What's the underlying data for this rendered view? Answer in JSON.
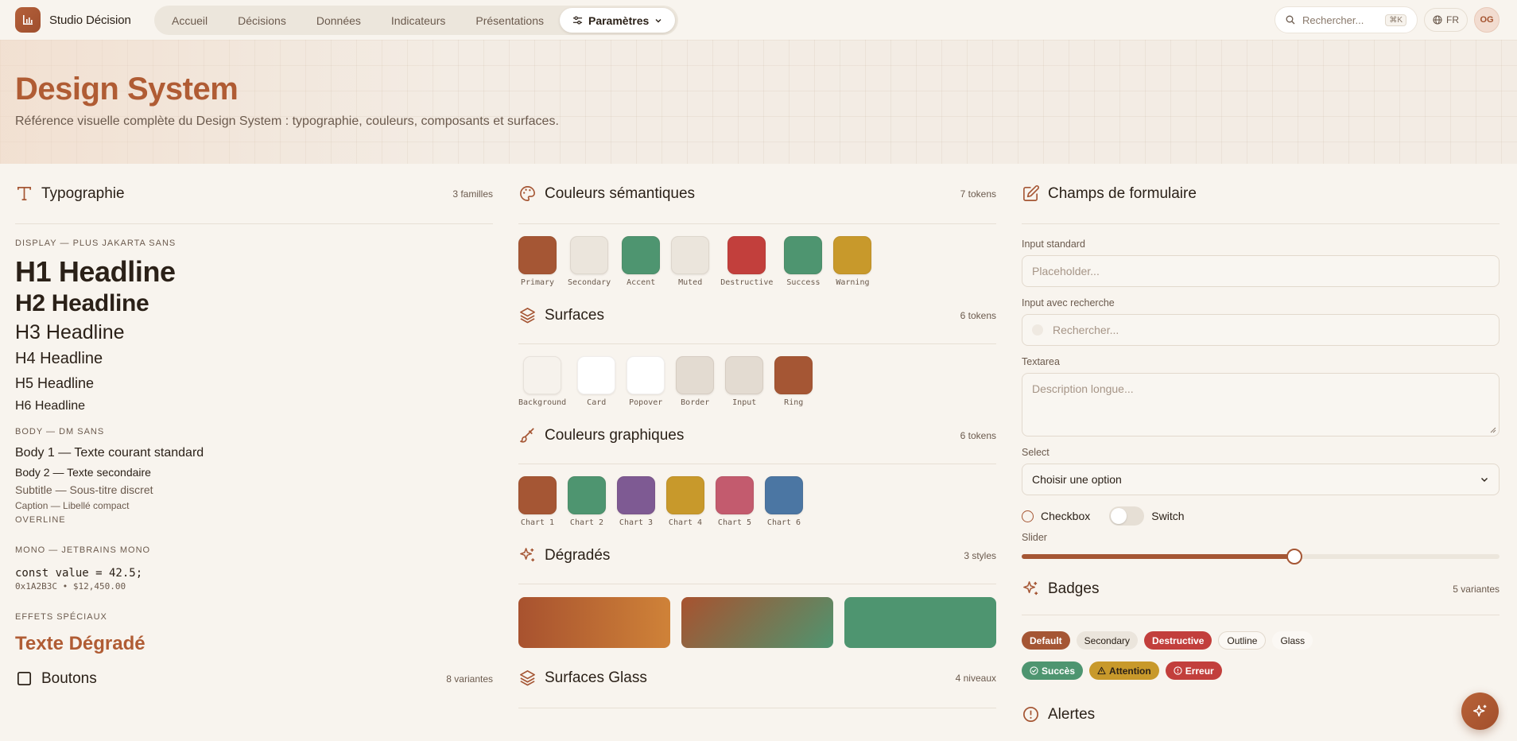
{
  "brand": {
    "name": "Studio Décision"
  },
  "nav": {
    "items": [
      {
        "label": "Accueil"
      },
      {
        "label": "Décisions"
      },
      {
        "label": "Données"
      },
      {
        "label": "Indicateurs"
      },
      {
        "label": "Présentations"
      }
    ],
    "active_label": "Paramètres"
  },
  "search": {
    "placeholder": "Rechercher...",
    "shortcut": "⌘K"
  },
  "lang": "FR",
  "avatar": "OG",
  "hero": {
    "title": "Design System",
    "subtitle": "Référence visuelle complète du Design System : typographie, couleurs, composants et surfaces."
  },
  "typography": {
    "title": "Typographie",
    "count": "3 familles",
    "display_overline": "Display — Plus Jakarta Sans",
    "headings": [
      "H1 Headline",
      "H2 Headline",
      "H3 Headline",
      "H4 Headline",
      "H5 Headline",
      "H6 Headline"
    ],
    "body_overline": "Body — DM Sans",
    "body1": "Body 1 — Texte courant standard",
    "body2": "Body 2 — Texte secondaire",
    "subtitle": "Subtitle — Sous-titre discret",
    "caption": "Caption — Libellé compact",
    "overline": "Overline",
    "mono_overline": "Mono — JetBrains Mono",
    "mono_code": "const value = 42.5;",
    "mono_small": "0x1A2B3C • $12,450.00",
    "effects_overline": "Effets spéciaux",
    "gradient_text": "Texte Dégradé"
  },
  "buttons": {
    "title": "Boutons",
    "count": "8 variantes"
  },
  "semantic_colors": {
    "title": "Couleurs sémantiques",
    "count": "7 tokens",
    "items": [
      {
        "label": "Primary",
        "color": "#a55634"
      },
      {
        "label": "Secondary",
        "color": "#ebe5dc"
      },
      {
        "label": "Accent",
        "color": "#4e9570"
      },
      {
        "label": "Muted",
        "color": "#ebe5dc"
      },
      {
        "label": "Destructive",
        "color": "#c23f3c"
      },
      {
        "label": "Success",
        "color": "#4e9570"
      },
      {
        "label": "Warning",
        "color": "#c8992b"
      }
    ]
  },
  "surfaces": {
    "title": "Surfaces",
    "count": "6 tokens",
    "items": [
      {
        "label": "Background",
        "color": "#f6f2ec"
      },
      {
        "label": "Card",
        "color": "#ffffff"
      },
      {
        "label": "Popover",
        "color": "#ffffff"
      },
      {
        "label": "Border",
        "color": "#e3dbd1"
      },
      {
        "label": "Input",
        "color": "#e3dbd1"
      },
      {
        "label": "Ring",
        "color": "#a55634"
      }
    ]
  },
  "chart_colors": {
    "title": "Couleurs graphiques",
    "count": "6 tokens",
    "items": [
      {
        "label": "Chart 1",
        "color": "#a55634"
      },
      {
        "label": "Chart 2",
        "color": "#4e9570"
      },
      {
        "label": "Chart 3",
        "color": "#7e5a93"
      },
      {
        "label": "Chart 4",
        "color": "#c8992b"
      },
      {
        "label": "Chart 5",
        "color": "#c35b6e"
      },
      {
        "label": "Chart 6",
        "color": "#4b76a3"
      }
    ]
  },
  "gradients": {
    "title": "Dégradés",
    "count": "3 styles"
  },
  "glass": {
    "title": "Surfaces Glass",
    "count": "4 niveaux"
  },
  "forms": {
    "title": "Champs de formulaire",
    "input_label": "Input standard",
    "input_placeholder": "Placeholder...",
    "search_label": "Input avec recherche",
    "search_placeholder": "Rechercher...",
    "textarea_label": "Textarea",
    "textarea_placeholder": "Description longue...",
    "select_label": "Select",
    "select_value": "Choisir une option",
    "checkbox_label": "Checkbox",
    "switch_label": "Switch",
    "slider_label": "Slider",
    "slider_value": 0.57
  },
  "badges": {
    "title": "Badges",
    "count": "5 variantes",
    "row1": [
      "Default",
      "Secondary",
      "Destructive",
      "Outline",
      "Glass"
    ],
    "row2": [
      "Succès",
      "Attention",
      "Erreur"
    ]
  },
  "alerts": {
    "title": "Alertes"
  }
}
